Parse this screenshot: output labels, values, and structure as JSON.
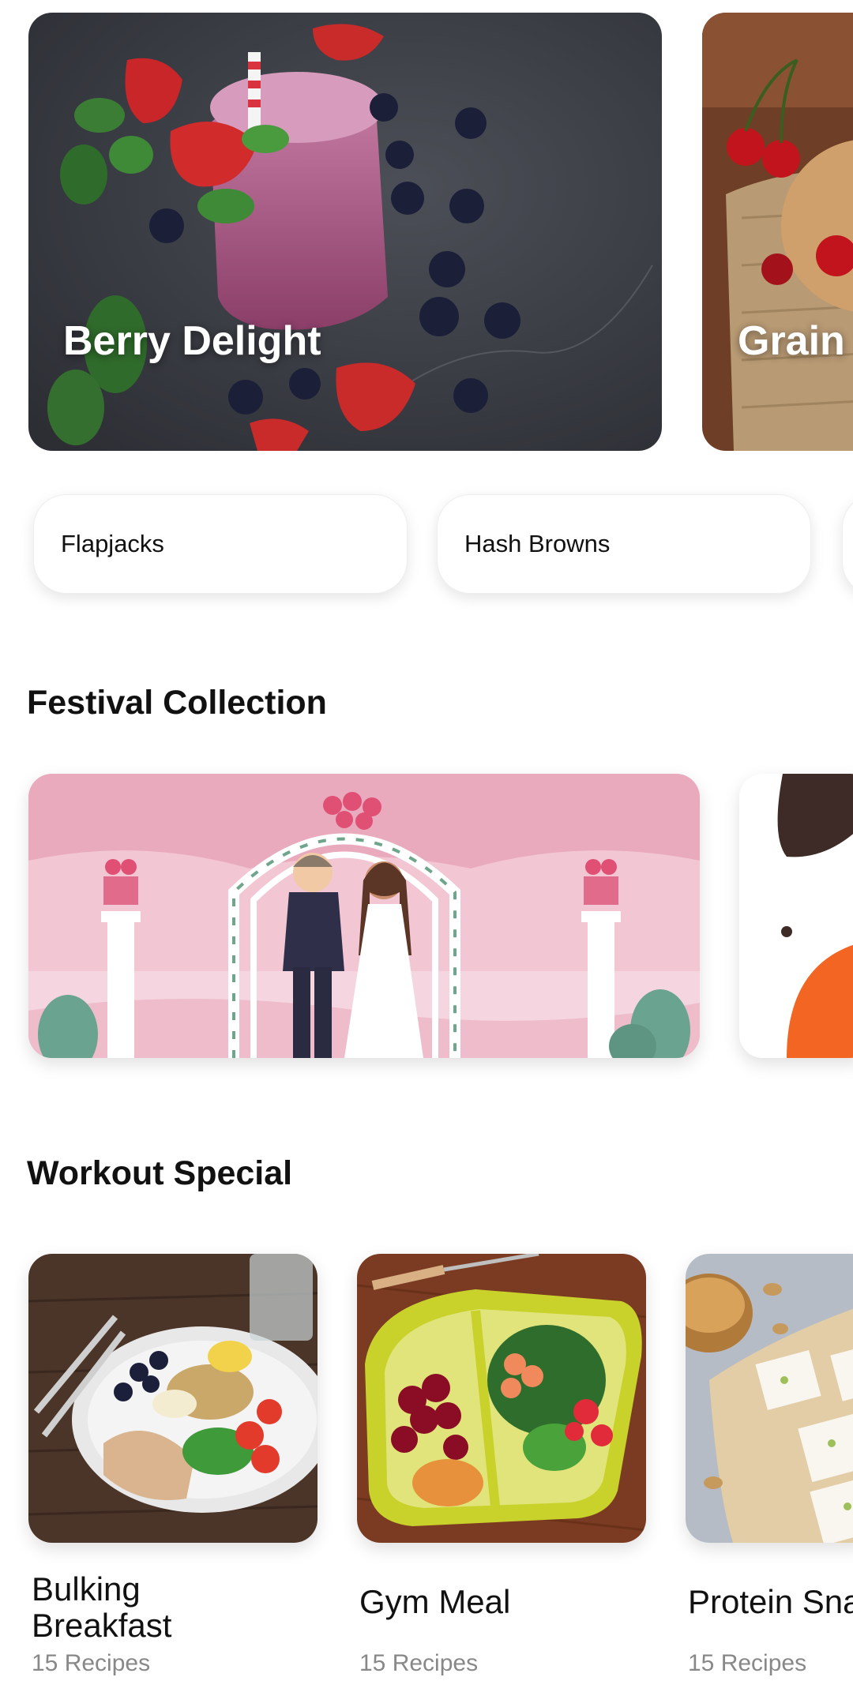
{
  "hero_cards": [
    {
      "title": "Berry Delight"
    },
    {
      "title": "Grain"
    }
  ],
  "chips": [
    {
      "label": "Flapjacks"
    },
    {
      "label": "Hash Browns"
    }
  ],
  "festival": {
    "title": "Festival Collection"
  },
  "workout": {
    "title": "Workout Special",
    "items": [
      {
        "title": "Bulking Breakfast",
        "count": "15 Recipes"
      },
      {
        "title": "Gym Meal",
        "count": "15 Recipes"
      },
      {
        "title": "Protein Sna",
        "count": "15 Recipes"
      }
    ]
  }
}
